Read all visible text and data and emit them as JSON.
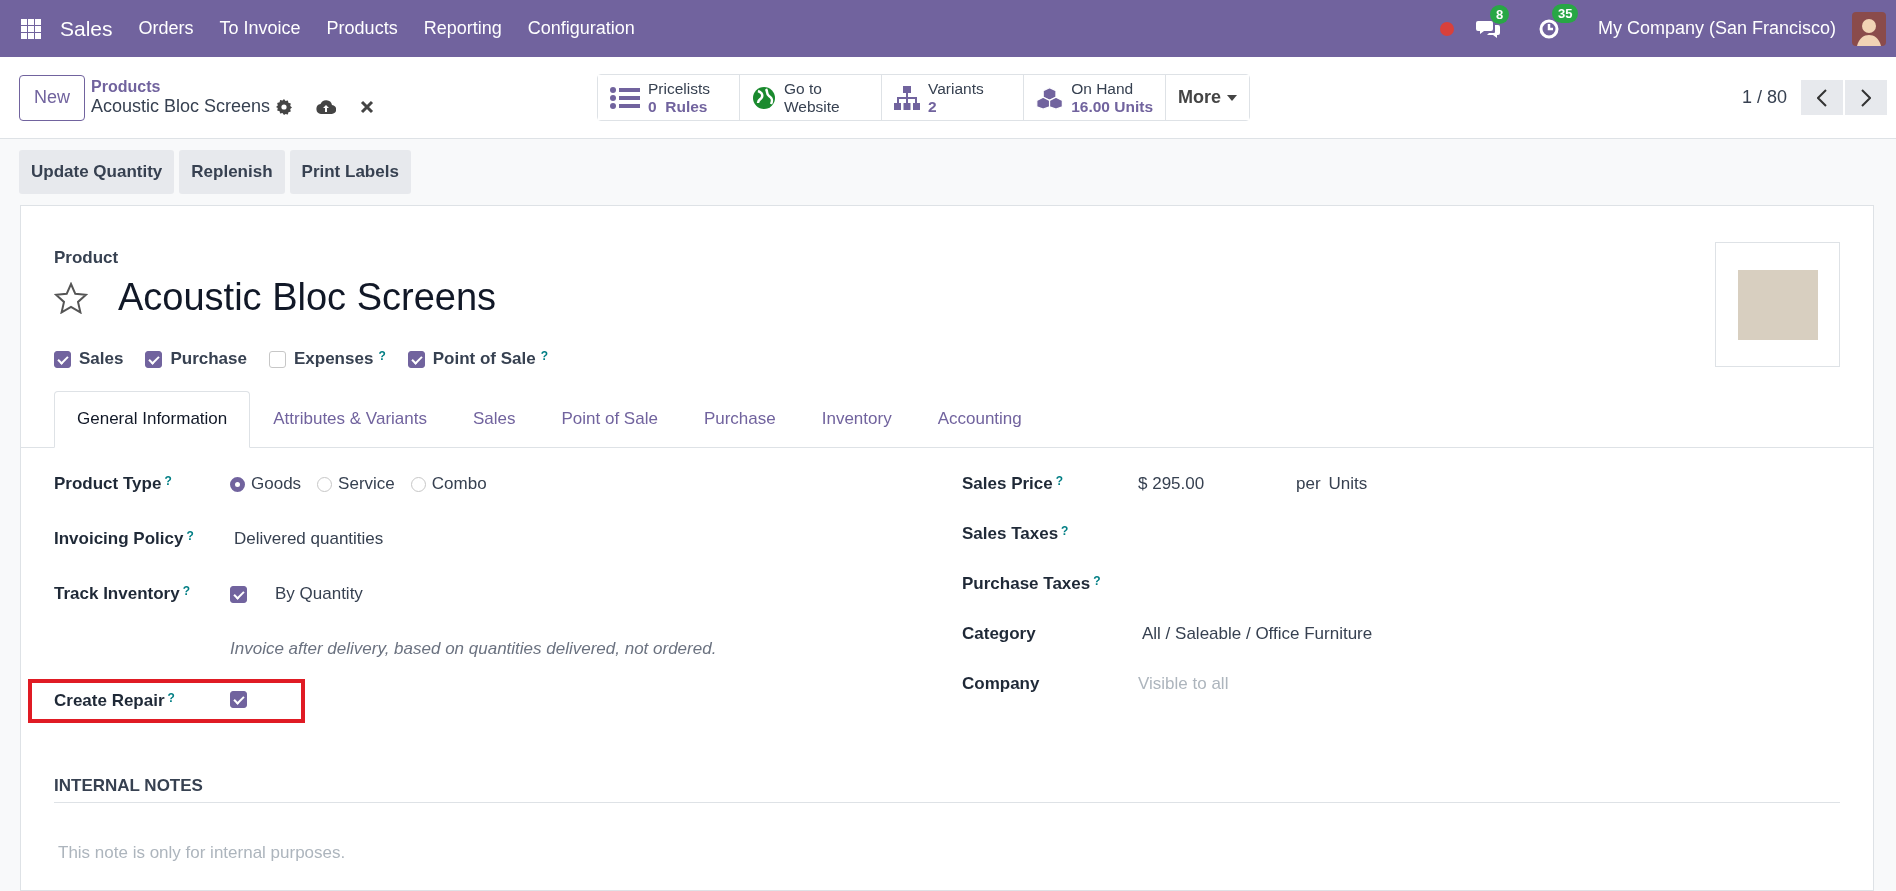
{
  "navbar": {
    "app": "Sales",
    "menu": [
      "Orders",
      "To Invoice",
      "Products",
      "Reporting",
      "Configuration"
    ],
    "messages_badge": "8",
    "activities_badge": "35",
    "company": "My Company (San Francisco)"
  },
  "control_panel": {
    "new_button": "New",
    "breadcrumb": "Products",
    "record": "Acoustic Bloc Screens",
    "stat_buttons": [
      {
        "kind": "list",
        "label": "Pricelists",
        "value": "0  Rules"
      },
      {
        "kind": "globe",
        "label": "Go to",
        "value": "Website"
      },
      {
        "kind": "hierarchy",
        "label": "Variants",
        "value": "2"
      },
      {
        "kind": "cubes",
        "label": "On Hand",
        "value": "16.00 Units"
      }
    ],
    "more": "More",
    "pager": "1 / 80"
  },
  "actions": [
    "Update Quantity",
    "Replenish",
    "Print Labels"
  ],
  "form": {
    "section_label": "Product",
    "favorite": false,
    "title": "Acoustic Bloc Screens",
    "options": [
      {
        "label": "Sales",
        "checked": true
      },
      {
        "label": "Purchase",
        "checked": true
      },
      {
        "label": "Expenses",
        "checked": false,
        "help": "?"
      },
      {
        "label": "Point of Sale",
        "checked": true,
        "help": "?"
      }
    ],
    "tabs": [
      {
        "label": "General Information",
        "selected": true
      },
      {
        "label": "Attributes & Variants",
        "selected": false
      },
      {
        "label": "Sales",
        "selected": false
      },
      {
        "label": "Point of Sale",
        "selected": false
      },
      {
        "label": "Purchase",
        "selected": false
      },
      {
        "label": "Inventory",
        "selected": false
      },
      {
        "label": "Accounting",
        "selected": false
      }
    ],
    "left_fields": [
      {
        "kind": "radio",
        "label": "Product Type",
        "help": "?",
        "options": [
          {
            "label": "Goods",
            "selected": true
          },
          {
            "label": "Service",
            "selected": false
          },
          {
            "label": "Combo",
            "selected": false
          }
        ]
      },
      {
        "kind": "text",
        "label": "Invoicing Policy",
        "help": "?",
        "value": "Delivered quantities"
      },
      {
        "kind": "checkbox",
        "label": "Track Inventory",
        "help": "?",
        "checked": true,
        "value": "By Quantity",
        "note": "Invoice after delivery, based on quantities delivered, not ordered."
      },
      {
        "kind": "checkbox",
        "label": "Create Repair",
        "help": "?",
        "checked": true,
        "highlighted": true
      }
    ],
    "right_fields": [
      {
        "kind": "price",
        "label": "Sales Price",
        "help": "?",
        "value": "$ 295.00",
        "per": "per",
        "unit": "Units"
      },
      {
        "kind": "text",
        "label": "Sales Taxes",
        "help": "?"
      },
      {
        "kind": "text",
        "label": "Purchase Taxes",
        "help": "?"
      },
      {
        "kind": "text",
        "label": "Category",
        "value": "All / Saleable / Office Furniture"
      },
      {
        "kind": "text",
        "label": "Company",
        "placeholder": "Visible to all"
      }
    ],
    "internal_notes": {
      "heading": "INTERNAL NOTES",
      "placeholder": "This note is only for internal purposes."
    }
  }
}
